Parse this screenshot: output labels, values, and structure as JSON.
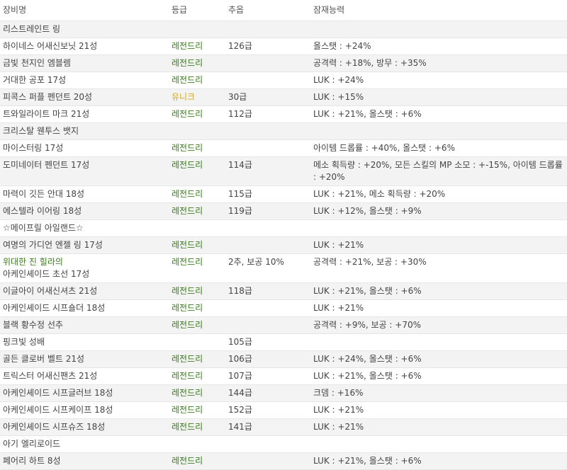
{
  "headers": [
    "장비명",
    "등급",
    "추옵",
    "잠재능력"
  ],
  "rows": [
    {
      "name": "리스트레인트 링",
      "grade": "",
      "flame": "",
      "potential": "",
      "name_color": "normal",
      "grade_type": ""
    },
    {
      "name": "하이네스 어새신보닛 21성",
      "grade": "레전드리",
      "flame": "126급",
      "potential": "올스탯 : +24%",
      "grade_type": "legendary"
    },
    {
      "name": "금빛 천지인 엠블렘",
      "grade": "레전드리",
      "flame": "",
      "potential": "공격력 : +18%, 방무 : +35%",
      "grade_type": "legendary"
    },
    {
      "name": "거대한 공포 17성",
      "grade": "레전드리",
      "flame": "",
      "potential": "LUK : +24%",
      "grade_type": "legendary"
    },
    {
      "name": "피콕스 퍼플 펜던트 20성",
      "grade": "유니크",
      "flame": "30급",
      "potential": "LUK : +15%",
      "grade_type": "unique"
    },
    {
      "name": "트와일라이트 마크 21성",
      "grade": "레전드리",
      "flame": "112급",
      "potential": "LUK : +21%, 올스탯 : +6%",
      "grade_type": "legendary"
    },
    {
      "name": "크리스탈 웬투스 뱃지",
      "grade": "",
      "flame": "",
      "potential": "",
      "grade_type": ""
    },
    {
      "name": "마이스터링 17성",
      "grade": "레전드리",
      "flame": "",
      "potential": "아이템 드롭률 : +40%, 올스탯 : +6%",
      "grade_type": "legendary"
    },
    {
      "name": "도미네이터 펜던트 17성",
      "grade": "레전드리",
      "flame": "114급",
      "potential": "메소 획득량 : +20%, 모든 스킬의 MP 소모 : +-15%, 아이템 드롭률 : +20%",
      "grade_type": "legendary"
    },
    {
      "name": "마력이 깃든 안대 18성",
      "grade": "레전드리",
      "flame": "115급",
      "potential": "LUK : +21%, 메소 획득량 : +20%",
      "grade_type": "legendary"
    },
    {
      "name": "에스텔라 이어링 18성",
      "grade": "레전드리",
      "flame": "119급",
      "potential": "LUK : +12%, 올스탯 : +9%",
      "grade_type": "legendary"
    },
    {
      "name": "☆메이프릴 아일랜드☆",
      "grade": "",
      "flame": "",
      "potential": "",
      "grade_type": ""
    },
    {
      "name": "여명의 가디언 엔젤 링 17성",
      "grade": "레전드리",
      "flame": "",
      "potential": "LUK : +21%",
      "grade_type": "legendary"
    },
    {
      "name_line1": "위대한 진 힐라의",
      "name_line2": "아케인셰이드 초선 17성",
      "grade": "레전드리",
      "flame": "2추, 보공 10%",
      "potential": "공격력 : +21%, 보공 : +30%",
      "grade_type": "legendary"
    },
    {
      "name": "이글아이 어새신셔츠 21성",
      "grade": "레전드리",
      "flame": "118급",
      "potential": "LUK : +21%, 올스탯 : +6%",
      "grade_type": "legendary"
    },
    {
      "name": "아케인셰이드 시프숄더 18성",
      "grade": "레전드리",
      "flame": "",
      "potential": "LUK : +21%",
      "grade_type": "legendary"
    },
    {
      "name": "블랙 황수정 선추",
      "grade": "레전드리",
      "flame": "",
      "potential": "공격력 : +9%, 보공 : +70%",
      "grade_type": "legendary"
    },
    {
      "name": "핑크빛 성배",
      "grade": "",
      "flame": "105급",
      "potential": "",
      "grade_type": ""
    },
    {
      "name": "골든 클로버 벨트 21성",
      "grade": "레전드리",
      "flame": "106급",
      "potential": "LUK : +24%, 올스탯 : +6%",
      "grade_type": "legendary"
    },
    {
      "name": "트릭스터 어새신팬츠 21성",
      "grade": "레전드리",
      "flame": "107급",
      "potential": "LUK : +21%, 올스탯 : +6%",
      "grade_type": "legendary"
    },
    {
      "name": "아케인셰이드 시프글러브 18성",
      "grade": "레전드리",
      "flame": "144급",
      "potential": "크뎀 : +16%",
      "grade_type": "legendary"
    },
    {
      "name": "아케인셰이드 시프케이프 18성",
      "grade": "레전드리",
      "flame": "152급",
      "potential": "LUK : +21%",
      "grade_type": "legendary"
    },
    {
      "name": "아케인셰이드 시프슈즈 18성",
      "grade": "레전드리",
      "flame": "141급",
      "potential": "LUK : +21%",
      "grade_type": "legendary"
    },
    {
      "name": "아기 엘리로이드",
      "grade": "",
      "flame": "",
      "potential": "",
      "grade_type": ""
    },
    {
      "name": "페어리 하트 8성",
      "grade": "레전드리",
      "flame": "",
      "potential": "LUK : +21%, 올스탯 : +6%",
      "grade_type": "legendary"
    }
  ]
}
